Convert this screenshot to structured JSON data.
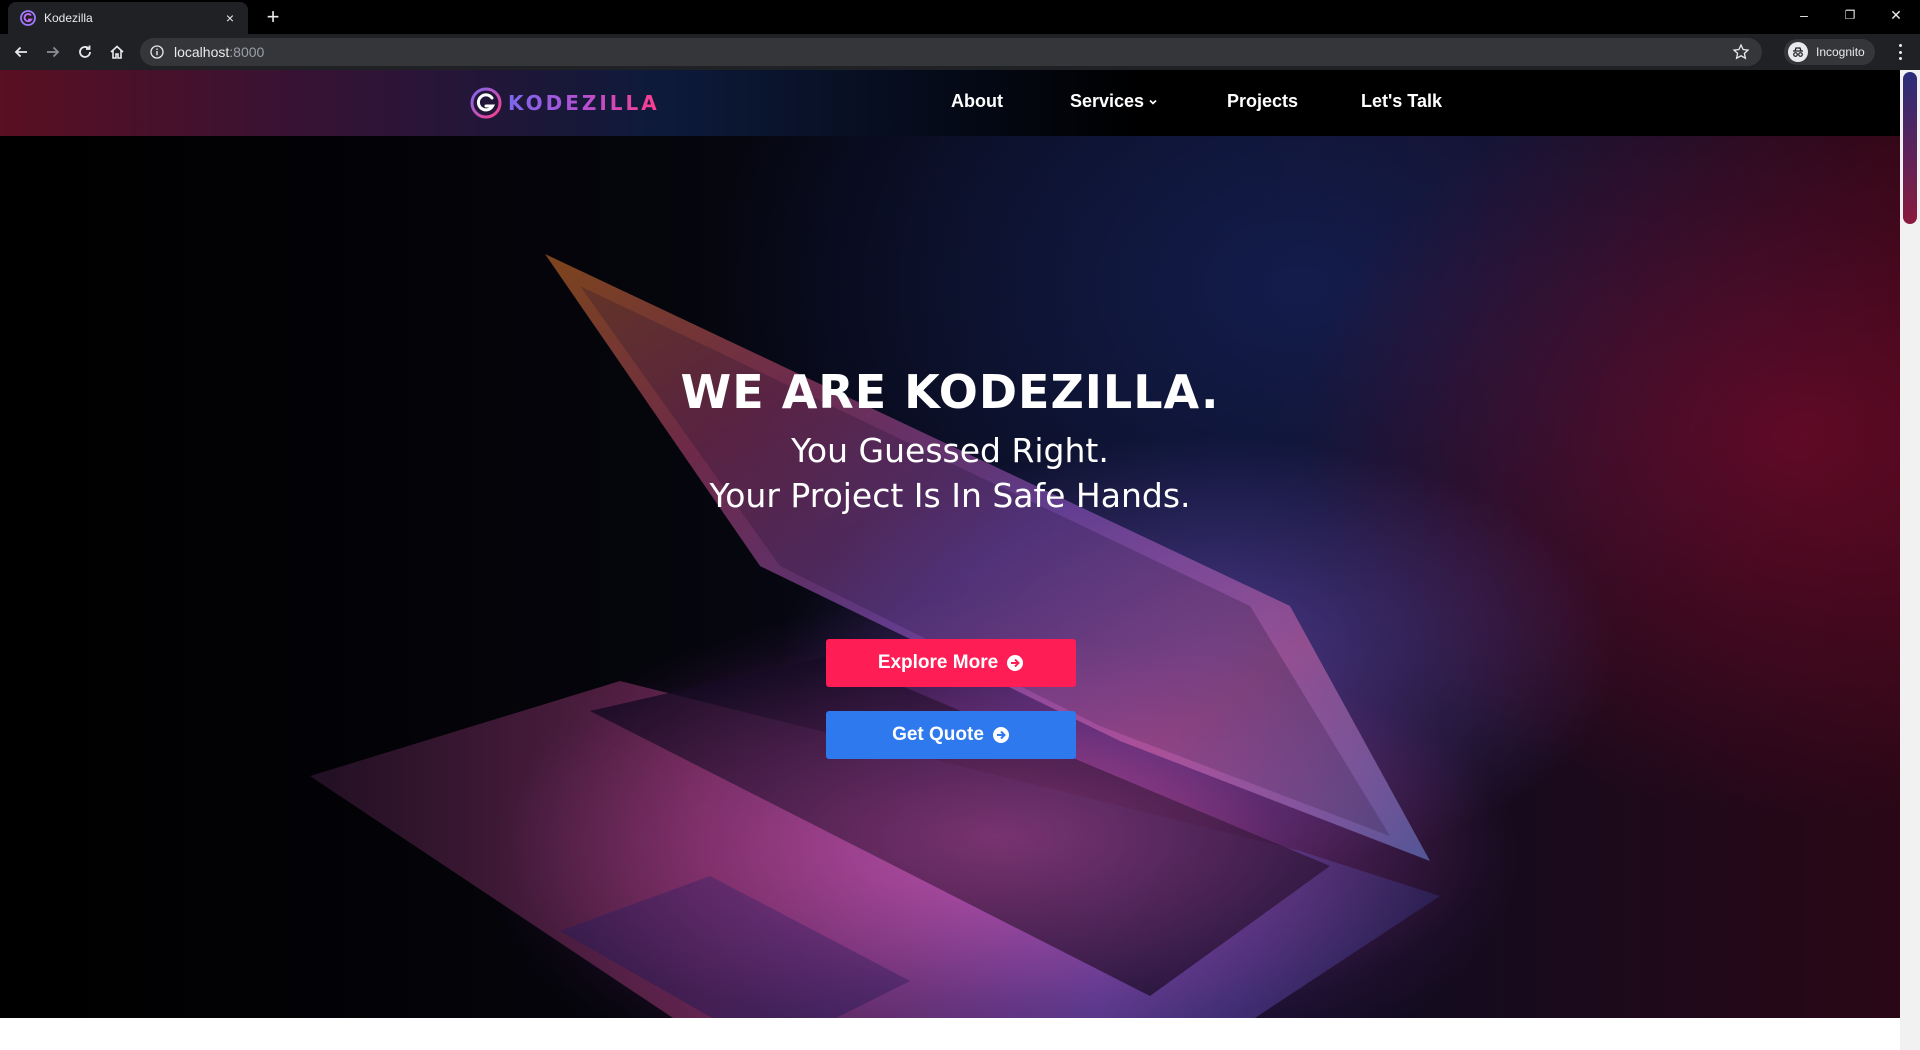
{
  "browser": {
    "tab_title": "Kodezilla",
    "tab_close": "×",
    "new_tab": "+",
    "url_host": "localhost",
    "url_port": ":8000",
    "profile_label": "Incognito",
    "window_controls": {
      "minimize": "–",
      "restore": "❐",
      "close": "✕"
    }
  },
  "site": {
    "brand": "KODEZILLA",
    "nav": [
      {
        "label": "About"
      },
      {
        "label": "Services",
        "has_dropdown": true
      },
      {
        "label": "Projects"
      },
      {
        "label": "Let's Talk"
      }
    ]
  },
  "hero": {
    "title": "WE ARE KODEZILLA.",
    "subtitle_line1": "You Guessed Right.",
    "subtitle_line2": "Your Project Is In Safe Hands.",
    "primary_button": "Explore More",
    "secondary_button": "Get Quote"
  },
  "colors": {
    "primary_button": "#ff1d55",
    "secondary_button": "#2e79ee",
    "brand_gradient_start": "#7b68ee",
    "brand_gradient_end": "#ff3d8b"
  },
  "icons": {
    "back": "arrow-left-icon",
    "forward": "arrow-right-icon",
    "reload": "reload-icon",
    "home": "home-icon",
    "site_info": "info-icon",
    "bookmark": "star-icon",
    "menu": "more-vertical-icon",
    "button_arrow": "arrow-circle-right-icon"
  }
}
